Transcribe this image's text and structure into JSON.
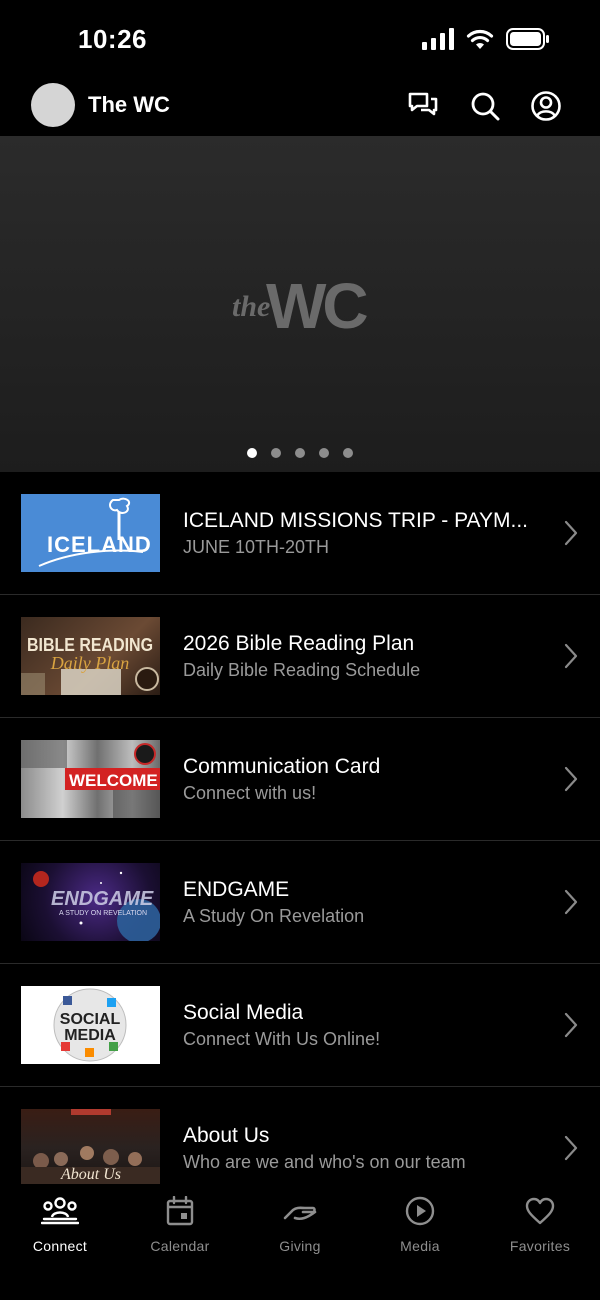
{
  "status_bar": {
    "time": "10:26"
  },
  "header": {
    "title": "The WC"
  },
  "hero": {
    "logo_text_small": "the",
    "logo_text_large": "WC",
    "slide_count": 5,
    "active_slide": 1
  },
  "list": [
    {
      "title": "ICELAND MISSIONS TRIP - PAYM...",
      "subtitle": "JUNE 10TH-20TH",
      "thumb_text": "ICELAND"
    },
    {
      "title": "2026 Bible Reading Plan",
      "subtitle": "Daily Bible Reading Schedule",
      "thumb_text": "BIBLE READING",
      "thumb_script": "Daily Plan"
    },
    {
      "title": "Communication Card",
      "subtitle": "Connect with us!",
      "thumb_text": "WELCOME"
    },
    {
      "title": "ENDGAME",
      "subtitle": "A Study On Revelation",
      "thumb_text": "ENDGAME",
      "thumb_sub": "A STUDY ON REVELATION"
    },
    {
      "title": "Social Media",
      "subtitle": "Connect With Us Online!",
      "thumb_text": "SOCIAL",
      "thumb_text2": "MEDIA"
    },
    {
      "title": "About Us",
      "subtitle": "Who are we and who's on our team",
      "thumb_script": "About Us"
    }
  ],
  "tabs": [
    {
      "label": "Connect",
      "icon": "people-icon",
      "active": true
    },
    {
      "label": "Calendar",
      "icon": "calendar-icon",
      "active": false
    },
    {
      "label": "Giving",
      "icon": "giving-hand-icon",
      "active": false
    },
    {
      "label": "Media",
      "icon": "play-circle-icon",
      "active": false
    },
    {
      "label": "Favorites",
      "icon": "heart-icon",
      "active": false
    }
  ],
  "colors": {
    "background": "#000000",
    "hero": "#262626",
    "subtitle": "#9a9a9a",
    "tab_inactive": "#8e8e8e",
    "iceland_blue": "#4a8bd6"
  }
}
